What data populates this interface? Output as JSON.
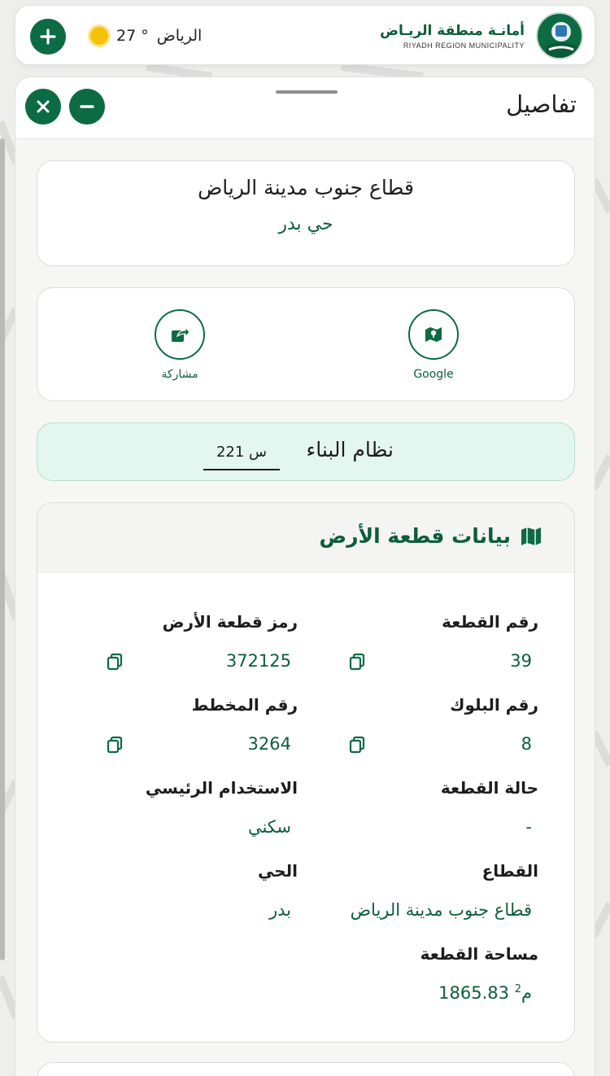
{
  "header": {
    "logo_ar": "أمانـة منطقة الريـاض",
    "logo_en": "RIYADH REGION MUNICIPALITY",
    "city": "الرياض",
    "temperature": "27 °",
    "sun_color": "#f5c10b"
  },
  "sheet": {
    "title": "تفاصيل"
  },
  "area": {
    "sector": "قطاع جنوب مدينة الرياض",
    "district": "حي بدر"
  },
  "actions": {
    "google_label": "Google",
    "share_label": "مشاركة"
  },
  "building_system": {
    "label": "نظام البناء",
    "value": "س 221"
  },
  "land": {
    "section_title": "بيانات قطعة الأرض",
    "plot_number_label": "رقم القطعة",
    "plot_number_value": "39",
    "land_code_label": "رمز قطعة الأرض",
    "land_code_value": "372125",
    "block_number_label": "رقم البلوك",
    "block_number_value": "8",
    "plan_number_label": "رقم المخطط",
    "plan_number_value": "3264",
    "plot_status_label": "حالة القطعة",
    "plot_status_value": "-",
    "main_use_label": "الاستخدام الرئيسي",
    "main_use_value": "سكني",
    "sector_label": "القطاع",
    "sector_value": "قطاع جنوب مدينة الرياض",
    "district_label": "الحي",
    "district_value": "بدر",
    "area_label": "مساحة القطعة",
    "area_value": "1865.83",
    "area_unit": "م",
    "area_unit_sup": "2"
  },
  "colors": {
    "brand_green": "#0c6b43",
    "text_green": "#0c5e3a",
    "building_bg": "#e3f6ef"
  }
}
